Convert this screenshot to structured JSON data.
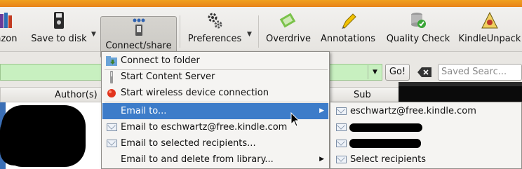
{
  "toolbar": {
    "items": [
      {
        "label": "azon",
        "icon": "books-icon"
      },
      {
        "label": "Save to disk",
        "icon": "disk-icon"
      },
      {
        "label": "Connect/share",
        "icon": "device-icon"
      },
      {
        "label": "Preferences",
        "icon": "gears-icon"
      },
      {
        "label": "Overdrive",
        "icon": "overdrive-icon"
      },
      {
        "label": "Annotations",
        "icon": "highlighter-icon"
      },
      {
        "label": "Quality Check",
        "icon": "db-check-icon"
      },
      {
        "label": "KindleUnpack",
        "icon": "unpack-icon"
      }
    ]
  },
  "search": {
    "go_label": "Go!",
    "saved_placeholder": "Saved Searc..."
  },
  "table": {
    "columns": [
      "Author(s)",
      "Sub"
    ]
  },
  "menu": {
    "items": [
      {
        "label": "Connect to folder",
        "icon": "folder-icon"
      },
      {
        "label": "Start Content Server",
        "icon": "server-icon"
      },
      {
        "label": "Start wireless device connection",
        "icon": "red-dot-icon"
      },
      {
        "label": "Email to...",
        "icon": "",
        "submenu": true
      },
      {
        "label": "Email to eschwartz@free.kindle.com",
        "icon": "envelope-icon"
      },
      {
        "label": "Email to selected recipients...",
        "icon": "envelope-icon"
      },
      {
        "label": "Email to and delete from library...",
        "icon": "",
        "submenu": true
      }
    ]
  },
  "submenu": {
    "items": [
      {
        "label": "eschwartz@free.kindle.com",
        "icon": "envelope-icon"
      },
      {
        "label": "",
        "icon": "envelope-icon",
        "redacted": true
      },
      {
        "label": "",
        "icon": "envelope-icon",
        "redacted": true
      },
      {
        "label": "Select recipients",
        "icon": "envelope-icon"
      }
    ]
  },
  "colors": {
    "highlight": "#3d7cc9",
    "search_bg": "#c8f0c0",
    "title_strip": "#e8821a"
  }
}
